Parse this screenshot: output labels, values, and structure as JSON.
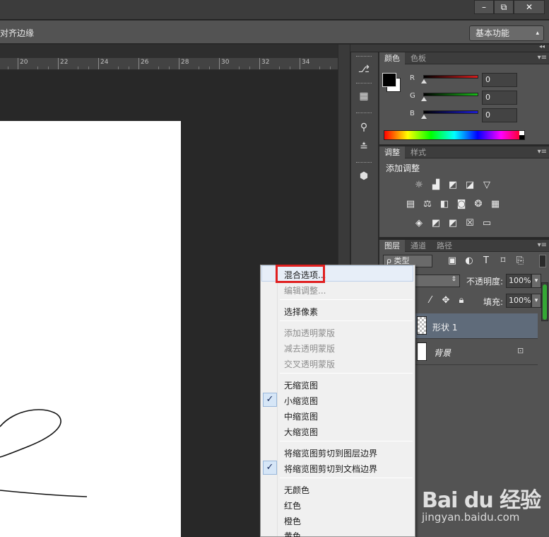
{
  "window": {
    "minimize": "–",
    "restore": "⧉",
    "close": "✕"
  },
  "options_bar": {
    "text": "对齐边缘",
    "workspace": "基本功能"
  },
  "ruler": {
    "labels": [
      "20",
      "22",
      "24",
      "26",
      "28",
      "30",
      "32",
      "34"
    ]
  },
  "panel_strip": {
    "collapse": "◂◂"
  },
  "color_panel": {
    "tabs": [
      "颜色",
      "色板"
    ],
    "channels": [
      {
        "label": "R",
        "value": "0",
        "color": "#d41c1c"
      },
      {
        "label": "G",
        "value": "0",
        "color": "#18b818"
      },
      {
        "label": "B",
        "value": "0",
        "color": "#1c1cd4"
      }
    ],
    "foreground": "#000000",
    "background": "#ffffff"
  },
  "adjust_panel": {
    "tabs": [
      "调整",
      "样式"
    ],
    "title": "添加调整"
  },
  "layers_panel": {
    "tabs": [
      "图层",
      "通道",
      "路径"
    ],
    "filter": "ρ 类型",
    "opacity_label": "不透明度:",
    "opacity_value": "100%",
    "fill_label": "填充:",
    "fill_value": "100%",
    "layers": [
      {
        "name": "形状 1",
        "selected": true
      },
      {
        "name": "背景",
        "selected": false,
        "locked": true
      }
    ]
  },
  "context_menu": {
    "items": [
      {
        "label": "混合选项...",
        "disabled": false,
        "highlighted": true
      },
      {
        "label": "编辑调整...",
        "disabled": true
      },
      {
        "label": "选择像素",
        "disabled": false
      },
      {
        "label": "添加透明蒙版",
        "disabled": true
      },
      {
        "label": "减去透明蒙版",
        "disabled": true
      },
      {
        "label": "交叉透明蒙版",
        "disabled": true
      },
      {
        "label": "无缩览图",
        "disabled": false
      },
      {
        "label": "小缩览图",
        "disabled": false,
        "checked": true
      },
      {
        "label": "中缩览图",
        "disabled": false
      },
      {
        "label": "大缩览图",
        "disabled": false
      },
      {
        "label": "将缩览图剪切到图层边界",
        "disabled": false
      },
      {
        "label": "将缩览图剪切到文档边界",
        "disabled": false,
        "checked": true
      },
      {
        "label": "无颜色",
        "disabled": false
      },
      {
        "label": "红色",
        "disabled": false
      },
      {
        "label": "橙色",
        "disabled": false
      },
      {
        "label": "黄色",
        "disabled": false
      }
    ],
    "check_glyph": "✓"
  },
  "watermark": {
    "brand": "Bai du 经验",
    "url": "jingyan.baidu.com"
  }
}
